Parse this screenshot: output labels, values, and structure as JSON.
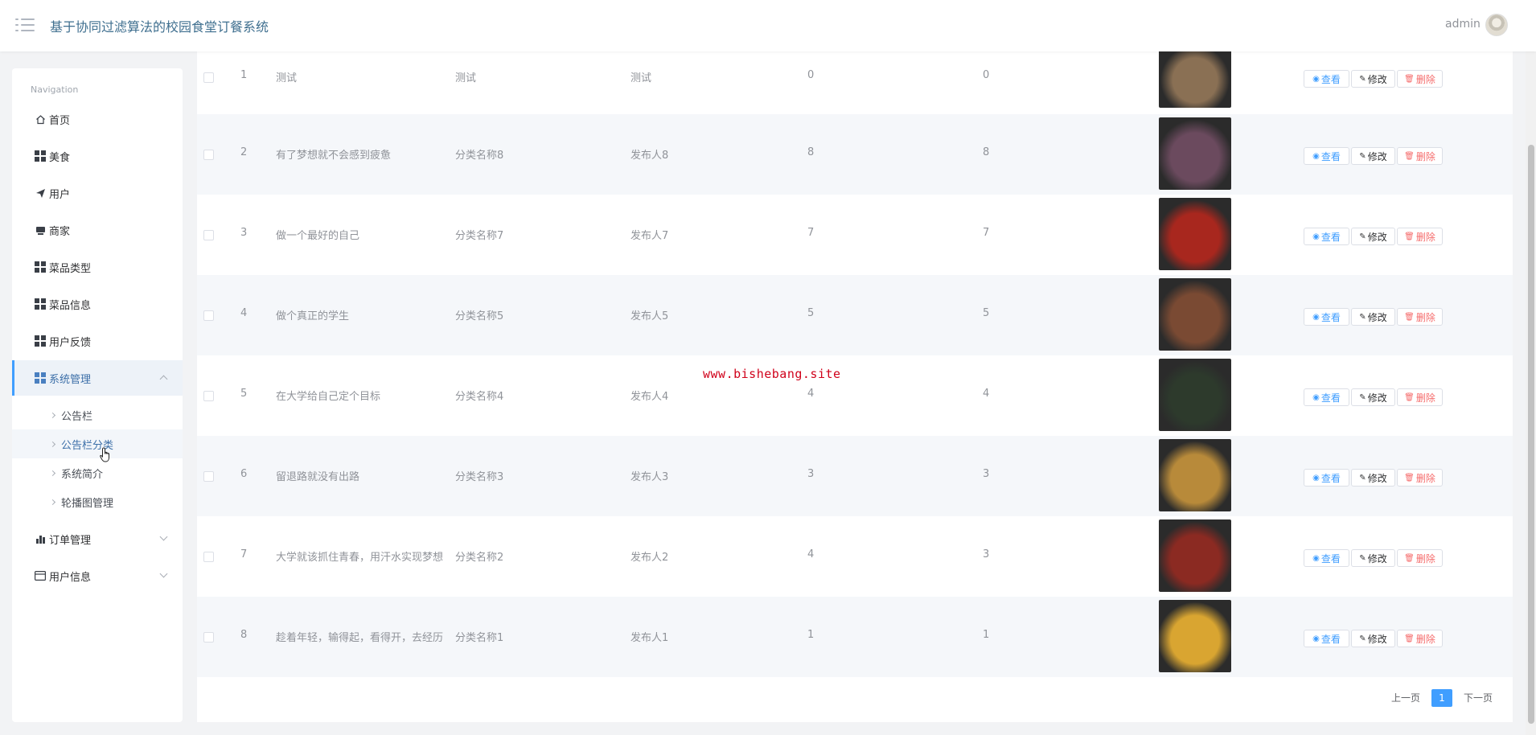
{
  "header": {
    "title": "基于协同过滤算法的校园食堂订餐系统",
    "user": "admin"
  },
  "sidebar": {
    "caption": "Navigation",
    "items": [
      {
        "label": "首页",
        "icon": "home-icon"
      },
      {
        "label": "美食",
        "icon": "grid-icon"
      },
      {
        "label": "用户",
        "icon": "paper-plane-icon"
      },
      {
        "label": "商家",
        "icon": "shop-icon"
      },
      {
        "label": "菜品类型",
        "icon": "grid-icon"
      },
      {
        "label": "菜品信息",
        "icon": "grid-icon"
      },
      {
        "label": "用户反馈",
        "icon": "grid-icon"
      },
      {
        "label": "系统管理",
        "icon": "grid-icon",
        "expanded": true
      },
      {
        "label": "订单管理",
        "icon": "bar-chart-icon"
      },
      {
        "label": "用户信息",
        "icon": "card-icon"
      }
    ],
    "sub_items": [
      "公告栏",
      "公告栏分类",
      "系统简介",
      "轮播图管理"
    ]
  },
  "table": {
    "rows": [
      {
        "index": "1",
        "title": "测试",
        "category": "测试",
        "publisher": "测试",
        "n1": "0",
        "n2": "0",
        "image_color": "#8a7054"
      },
      {
        "index": "2",
        "title": "有了梦想就不会感到疲惫",
        "category": "分类名称8",
        "publisher": "发布人8",
        "n1": "8",
        "n2": "8",
        "image_color": "#6b4a5e"
      },
      {
        "index": "3",
        "title": "做一个最好的自己",
        "category": "分类名称7",
        "publisher": "发布人7",
        "n1": "7",
        "n2": "7",
        "image_color": "#a8271e"
      },
      {
        "index": "4",
        "title": "做个真正的学生",
        "category": "分类名称5",
        "publisher": "发布人5",
        "n1": "5",
        "n2": "5",
        "image_color": "#7a4a33"
      },
      {
        "index": "5",
        "title": "在大学给自己定个目标",
        "category": "分类名称4",
        "publisher": "发布人4",
        "n1": "4",
        "n2": "4",
        "image_color": "#2d3a2c"
      },
      {
        "index": "6",
        "title": "留退路就没有出路",
        "category": "分类名称3",
        "publisher": "发布人3",
        "n1": "3",
        "n2": "3",
        "image_color": "#b88a3a"
      },
      {
        "index": "7",
        "title": "大学就该抓住青春，用汗水实现梦想",
        "category": "分类名称2",
        "publisher": "发布人2",
        "n1": "4",
        "n2": "3",
        "image_color": "#8b2a22"
      },
      {
        "index": "8",
        "title": "趁着年轻，输得起，看得开，去经历",
        "category": "分类名称1",
        "publisher": "发布人1",
        "n1": "1",
        "n2": "1",
        "image_color": "#d9a531"
      }
    ],
    "view_label": "查看",
    "edit_label": "修改",
    "delete_label": "删除"
  },
  "pagination": {
    "prev": "上一页",
    "current": "1",
    "next": "下一页"
  },
  "watermark": "www.bishebang.site",
  "colors": {
    "primary": "#409eff",
    "danger": "#f56c6c",
    "title": "#3f6f8f"
  }
}
